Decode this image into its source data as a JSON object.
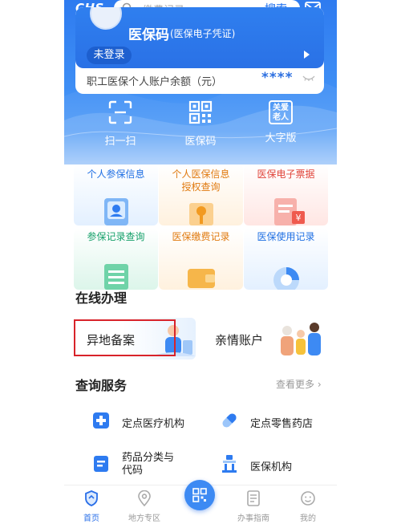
{
  "header": {
    "logo": "CHS",
    "search_placeholder": "缴费记录",
    "search_button": "搜索"
  },
  "code_card": {
    "title": "医保码",
    "subtitle": "(医保电子凭证)",
    "login_label": "未登录",
    "balance_label": "职工医保个人账户余额（元）",
    "balance_value": "****"
  },
  "quick_actions": [
    {
      "label": "扫一扫",
      "icon": "scan-icon"
    },
    {
      "label": "医保码",
      "icon": "qr-code-icon"
    },
    {
      "label": "大字版",
      "icon": "elderly-mode-icon",
      "badge": "关爱\n老人"
    }
  ],
  "services_grid": [
    {
      "label": "个人参保信息",
      "color": "#1f6fe3"
    },
    {
      "label": "个人医保信息\n授权查询",
      "color": "#e07a10"
    },
    {
      "label": "医保电子票据",
      "color": "#e0443a"
    },
    {
      "label": "参保记录查询",
      "color": "#15a06a"
    },
    {
      "label": "医保缴费记录",
      "color": "#e07a10"
    },
    {
      "label": "医保使用记录",
      "color": "#1f6fe3"
    }
  ],
  "online": {
    "title": "在线办理",
    "items": [
      {
        "label": "异地备案"
      },
      {
        "label": "亲情账户"
      }
    ]
  },
  "query": {
    "title": "查询服务",
    "more": "查看更多",
    "items": [
      {
        "label": "定点医疗机构",
        "icon": "hospital-icon"
      },
      {
        "label": "定点零售药店",
        "icon": "pill-icon"
      },
      {
        "label": "药品分类与\n代码",
        "icon": "drug-document-icon"
      },
      {
        "label": "医保机构",
        "icon": "institution-icon"
      }
    ]
  },
  "tabbar": {
    "items": [
      {
        "label": "首页",
        "icon": "home-shield-icon",
        "active": true
      },
      {
        "label": "地方专区",
        "icon": "location-pin-icon",
        "active": false
      },
      {
        "label": "办事指南",
        "icon": "guide-document-icon",
        "active": false
      },
      {
        "label": "我的",
        "icon": "user-face-icon",
        "active": false
      }
    ]
  },
  "colors": {
    "brand_blue": "#2e7bf0",
    "accent_red": "#d8232a"
  }
}
